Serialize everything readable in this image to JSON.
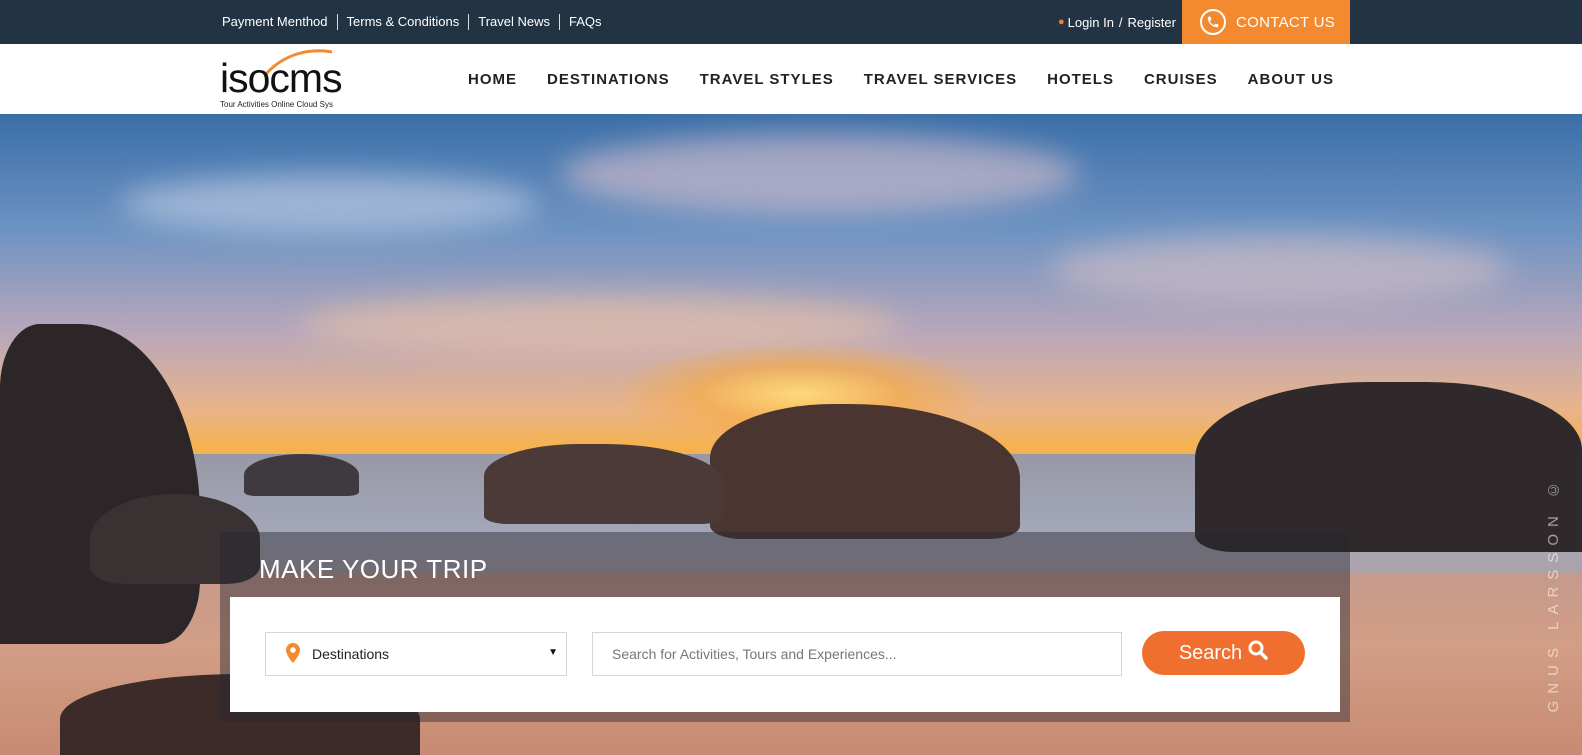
{
  "topbar": {
    "links": [
      "Payment Menthod",
      "Terms & Conditions",
      "Travel News",
      "FAQs"
    ],
    "login_label": "Login In",
    "separator": "/",
    "register_label": "Register",
    "contact_label": "CONTACT US",
    "background_color": "#223444",
    "accent_color": "#f48a2f"
  },
  "logo": {
    "wordmark": "isocms",
    "tagline": "Tour Activities Online Cloud Sys"
  },
  "nav": {
    "items": [
      "HOME",
      "DESTINATIONS",
      "TRAVEL STYLES",
      "TRAVEL SERVICES",
      "HOTELS",
      "CRUISES",
      "ABOUT US"
    ]
  },
  "hero": {
    "watermark": "GNUS LARSSON ©"
  },
  "search": {
    "title": "MAKE YOUR TRIP",
    "destination_value": "Destinations",
    "placeholder": "Search for Activities, Tours and Experiences...",
    "button_label": "Search",
    "button_color": "#f06f2e"
  }
}
